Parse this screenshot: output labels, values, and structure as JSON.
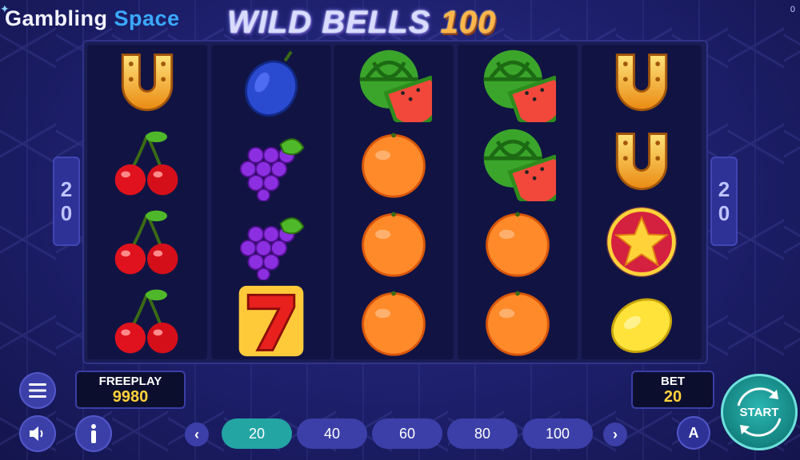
{
  "brand": {
    "word1": "Gambling",
    "word2": "Space"
  },
  "title": {
    "main": "WILD BELLS",
    "number": "100"
  },
  "corner_value": "0",
  "reels": [
    [
      "horseshoe",
      "cherry",
      "cherry",
      "cherry"
    ],
    [
      "plum",
      "grapes",
      "grapes",
      "seven"
    ],
    [
      "watermelon",
      "orange",
      "orange",
      "orange"
    ],
    [
      "watermelon",
      "watermelon",
      "orange",
      "orange"
    ],
    [
      "horseshoe",
      "horseshoe",
      "star",
      "lemon"
    ]
  ],
  "lines": {
    "left": [
      "2",
      "0"
    ],
    "right": [
      "2",
      "0"
    ]
  },
  "freeplay": {
    "label": "FREEPLAY",
    "value": "9980"
  },
  "bet": {
    "label": "BET",
    "value": "20"
  },
  "bet_options": [
    "20",
    "40",
    "60",
    "80",
    "100"
  ],
  "bet_selected": "20",
  "controls": {
    "start_label": "START",
    "auto_label": "A"
  },
  "colors": {
    "accent_teal": "#23a5a4",
    "value_yellow": "#ffd23a",
    "panel_blue": "#3c3fa8"
  }
}
